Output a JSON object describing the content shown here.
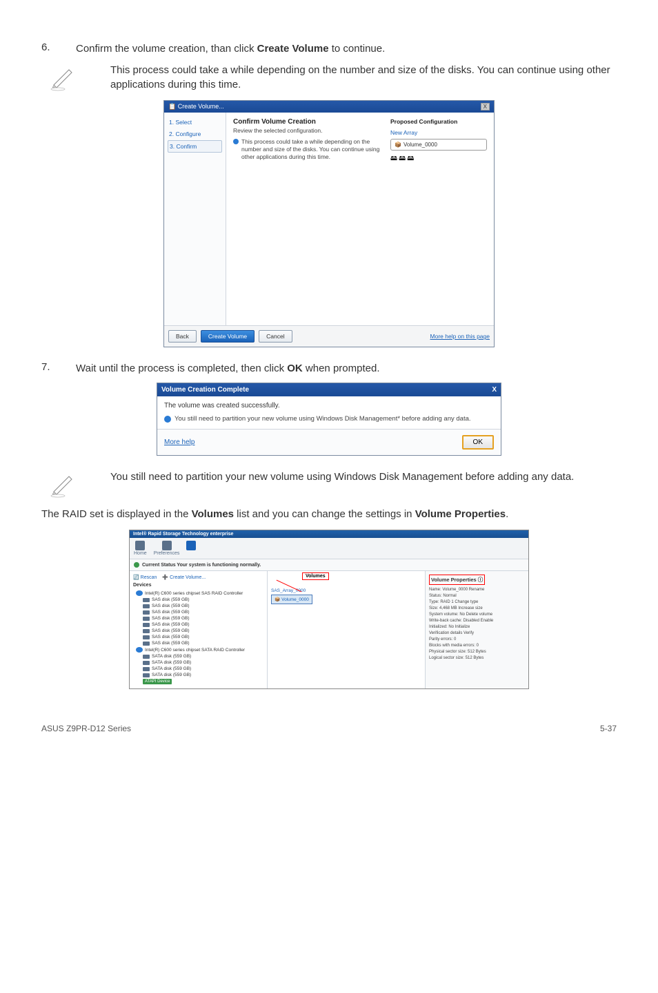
{
  "step6": {
    "num": "6.",
    "text_before": "Confirm the volume creation, than click ",
    "bold": "Create Volume",
    "text_after": " to continue."
  },
  "note1": {
    "text": "This process could take a while depending on the number and size of the disks. You can continue using other applications during this time."
  },
  "dlg1": {
    "title": "Create Volume...",
    "close": "X",
    "side": {
      "s1": "1. Select",
      "s2": "2. Configure",
      "s3": "3. Confirm"
    },
    "heading": "Confirm Volume Creation",
    "subtitle": "Review the selected configuration.",
    "info": "This process could take a while depending on the number and size of the disks. You can continue using other applications during this time.",
    "proposed_h": "Proposed Configuration",
    "array": "New Array",
    "volume": "Volume_0000",
    "btn_back": "Back",
    "btn_create": "Create Volume",
    "btn_cancel": "Cancel",
    "help": "More help on this page"
  },
  "step7": {
    "num": "7.",
    "text_before": "Wait until the process is completed, then click ",
    "bold": "OK",
    "text_after": " when prompted."
  },
  "dlg2": {
    "title": "Volume Creation Complete",
    "close": "X",
    "msg": "The volume was created successfully.",
    "info": "You still need to partition your new volume using Windows Disk Management* before adding any data.",
    "more": "More help",
    "ok": "OK"
  },
  "note2": {
    "text": "You still need to partition your new volume using Windows Disk Management before adding any data."
  },
  "para": {
    "t1": "The RAID set is displayed in the ",
    "b1": "Volumes",
    "t2": " list and you can change the settings in ",
    "b2": "Volume Properties",
    "t3": "."
  },
  "app": {
    "title": "Intel® Rapid Storage Technology enterprise",
    "tb_home": "Home",
    "tb_pref": "Preferences",
    "status": "Current Status Your system is functioning normally.",
    "rescan": "Rescan",
    "create": "Create Volume...",
    "volumes_label": "Volumes",
    "devices_h": "Devices",
    "ctrl1": "Intel(R) C600 series chipset SAS RAID Controller",
    "disk1": "SAS disk (559 GB)",
    "disk2": "SAS disk (559 GB)",
    "disk3": "SAS disk (559 GB)",
    "disk4": "SAS disk (559 GB)",
    "disk5": "SAS disk (559 GB)",
    "disk6": "SAS disk (559 GB)",
    "disk7": "SAS disk (559 GB)",
    "disk8": "SAS disk (559 GB)",
    "ctrl2": "Intel(R) C600 series chipset SATA RAID Controller",
    "sdisk1": "SATA disk (559 GB)",
    "sdisk2": "SATA disk (559 GB)",
    "sdisk3": "SATA disk (559 GB)",
    "sdisk4": "SATA disk (559 GB)",
    "atapi": "ATAPI Device",
    "array_name": "SAS_Array_0000",
    "vol_name": "Volume_0000",
    "props_h": "Volume Properties",
    "p_name": "Name: Volume_0000 Rename",
    "p_status": "Status: Normal",
    "p_type": "Type: RAID 1 Change type",
    "p_size": "Size: 4,468 MB Increase size",
    "p_sys": "System volume: No Delete volume",
    "p_wb": "Write-back cache: Disabled Enable",
    "p_init": "Initialized: No Initialize",
    "p_verif": "Verification details Verify",
    "p_parity": "Parity errors: 0",
    "p_blocks": "Blocks with media errors: 0",
    "p_phys": "Physical sector size: 512 Bytes",
    "p_log": "Logical sector size: 512 Bytes"
  },
  "footer": {
    "left": "ASUS Z9PR-D12 Series",
    "right": "5-37"
  }
}
